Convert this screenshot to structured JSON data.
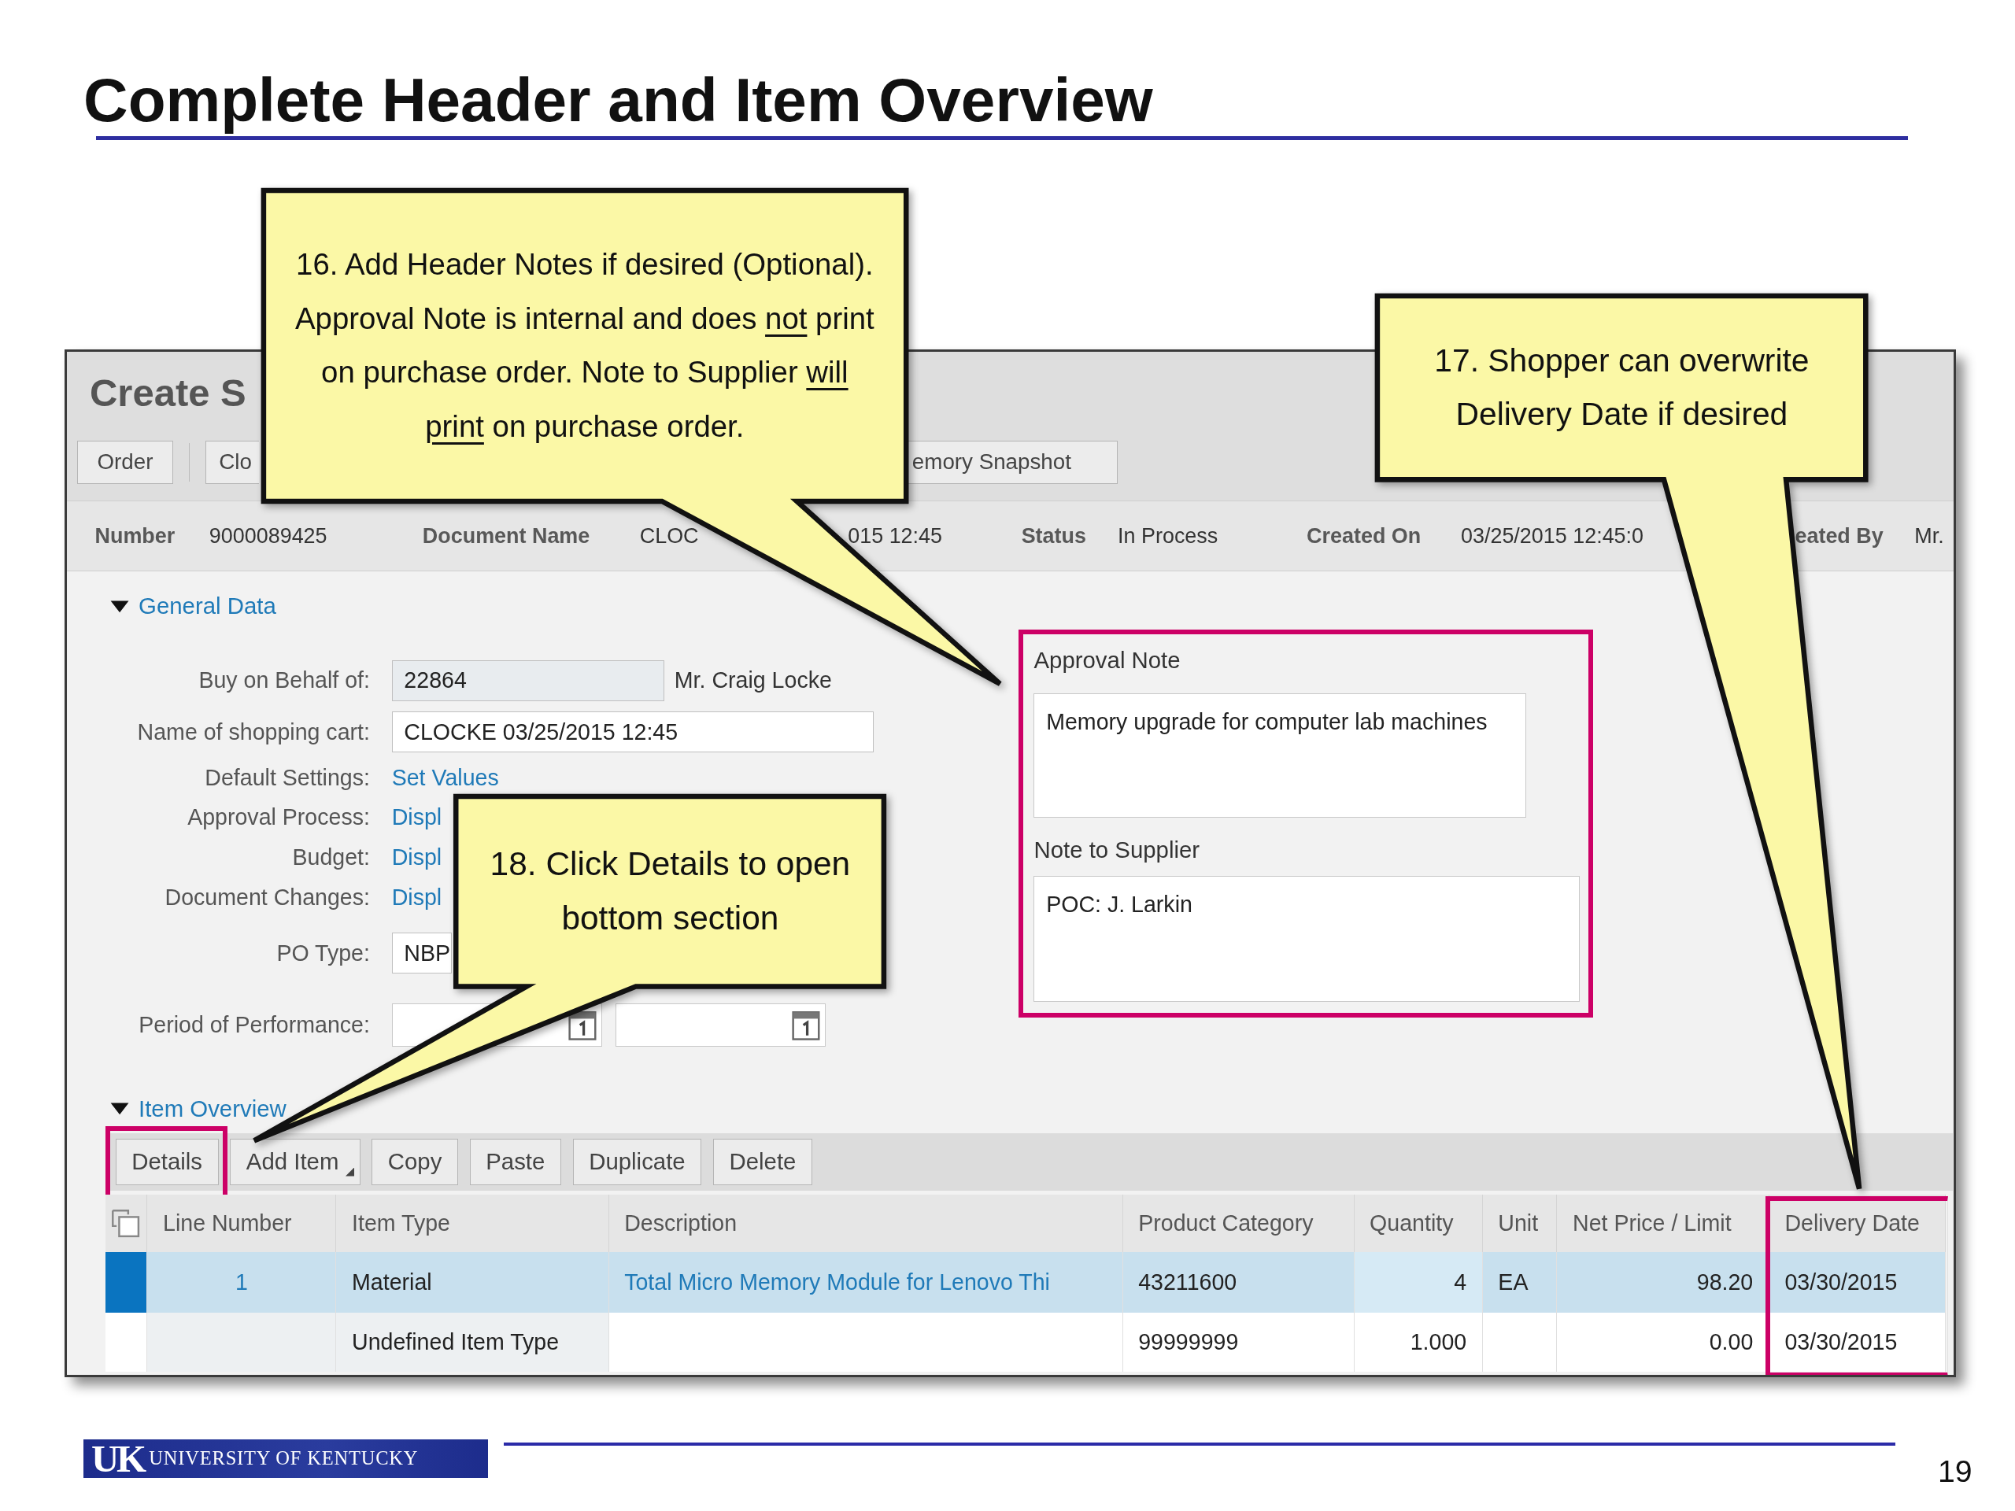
{
  "slide_title": "Complete Header and Item Overview",
  "window": {
    "title": "Create S",
    "toolbar_buttons": [
      "Order",
      "Clo",
      "emory Snapshot"
    ],
    "header_info": [
      {
        "kind": "label",
        "text": "Number"
      },
      {
        "kind": "value",
        "text": "9000089425"
      },
      {
        "kind": "label",
        "text": "Document Name"
      },
      {
        "kind": "value",
        "text": "CLOC"
      },
      {
        "kind": "value",
        "text": "015 12:45"
      },
      {
        "kind": "label",
        "text": "Status"
      },
      {
        "kind": "value",
        "text": "In Process"
      },
      {
        "kind": "label",
        "text": "Created On"
      },
      {
        "kind": "value",
        "text": "03/25/2015 12:45:0"
      },
      {
        "kind": "label",
        "text": "eated By"
      },
      {
        "kind": "value",
        "text": "Mr."
      }
    ],
    "general_data": {
      "title": "General Data",
      "expanded": true,
      "fields": [
        {
          "label": "Buy on Behalf of:",
          "kind": "field",
          "value": "22864",
          "disabled": true,
          "note": "Mr. Craig Locke"
        },
        {
          "label": "Name of shopping cart:",
          "kind": "field",
          "value": "CLOCKE 03/25/2015 12:45",
          "disabled": false
        },
        {
          "label": "Default Settings:",
          "kind": "link",
          "value": "Set Values",
          "disabled": false
        },
        {
          "label": "Approval Process:",
          "kind": "link",
          "value": "Displ",
          "disabled": false
        },
        {
          "label": "Budget:",
          "kind": "link",
          "value": "Displ",
          "disabled": false
        },
        {
          "label": "Document Changes:",
          "kind": "link",
          "value": "Displ",
          "disabled": false
        },
        {
          "label": "PO Type:",
          "kind": "field",
          "value": "NBP",
          "disabled": false
        },
        {
          "label": "Period of Performance:",
          "kind": "date_range",
          "disabled": false
        }
      ]
    },
    "notes": [
      {
        "label": "Approval Note",
        "value": "Memory upgrade for computer lab machines"
      },
      {
        "label": "Note to Supplier",
        "value": "POC: J. Larkin"
      }
    ],
    "item_overview": {
      "title": "Item Overview",
      "expanded": true,
      "buttons": [
        {
          "label": "Details",
          "highlighted": true,
          "menu": false
        },
        {
          "label": "Add Item",
          "highlighted": false,
          "menu": true
        },
        {
          "label": "Copy",
          "highlighted": false,
          "menu": false
        },
        {
          "label": "Paste",
          "highlighted": false,
          "menu": false
        },
        {
          "label": "Duplicate",
          "highlighted": false,
          "menu": false
        },
        {
          "label": "Delete",
          "highlighted": false,
          "menu": false
        }
      ],
      "columns": [
        {
          "label": "Line Number",
          "highlighted": false
        },
        {
          "label": "Item Type",
          "highlighted": false
        },
        {
          "label": "Description",
          "highlighted": false
        },
        {
          "label": "Product Category",
          "highlighted": false
        },
        {
          "label": "Quantity",
          "highlighted": false
        },
        {
          "label": "Unit",
          "highlighted": false
        },
        {
          "label": "Net Price / Limit",
          "highlighted": false
        },
        {
          "label": "Delivery Date",
          "highlighted": true
        }
      ],
      "rows": [
        {
          "selected": true,
          "line_number": "1",
          "item_type": "Material",
          "description": "Total Micro Memory Module for Lenovo Thi",
          "product_category": "43211600",
          "quantity": "4",
          "unit": "EA",
          "net_price": "98.20",
          "delivery_date": "03/30/2015"
        },
        {
          "selected": false,
          "item_type": "Undefined Item Type",
          "product_category": "99999999",
          "quantity": "1.000",
          "net_price": "0.00",
          "delivery_date": "03/30/2015"
        }
      ]
    }
  },
  "callouts": [
    {
      "parts": [
        {
          "text": "16. Add Header Notes if desired (Optional). Approval Note is internal and does ",
          "underline": false
        },
        {
          "text": "not",
          "underline": true
        },
        {
          "text": " print on purchase order. Note to Supplier ",
          "underline": false
        },
        {
          "text": "will print",
          "underline": true
        },
        {
          "text": " on purchase order.",
          "underline": false
        }
      ]
    },
    {
      "parts": [
        {
          "text": "17. Shopper can overwrite Delivery Date if desired",
          "underline": false
        }
      ]
    },
    {
      "parts": [
        {
          "text": "18. Click Details to open bottom section",
          "underline": false
        }
      ]
    }
  ],
  "footer": {
    "logo_mark": "UK",
    "logo_name": "UNIVERSITY OF KENTUCKY",
    "page_number": "19"
  }
}
